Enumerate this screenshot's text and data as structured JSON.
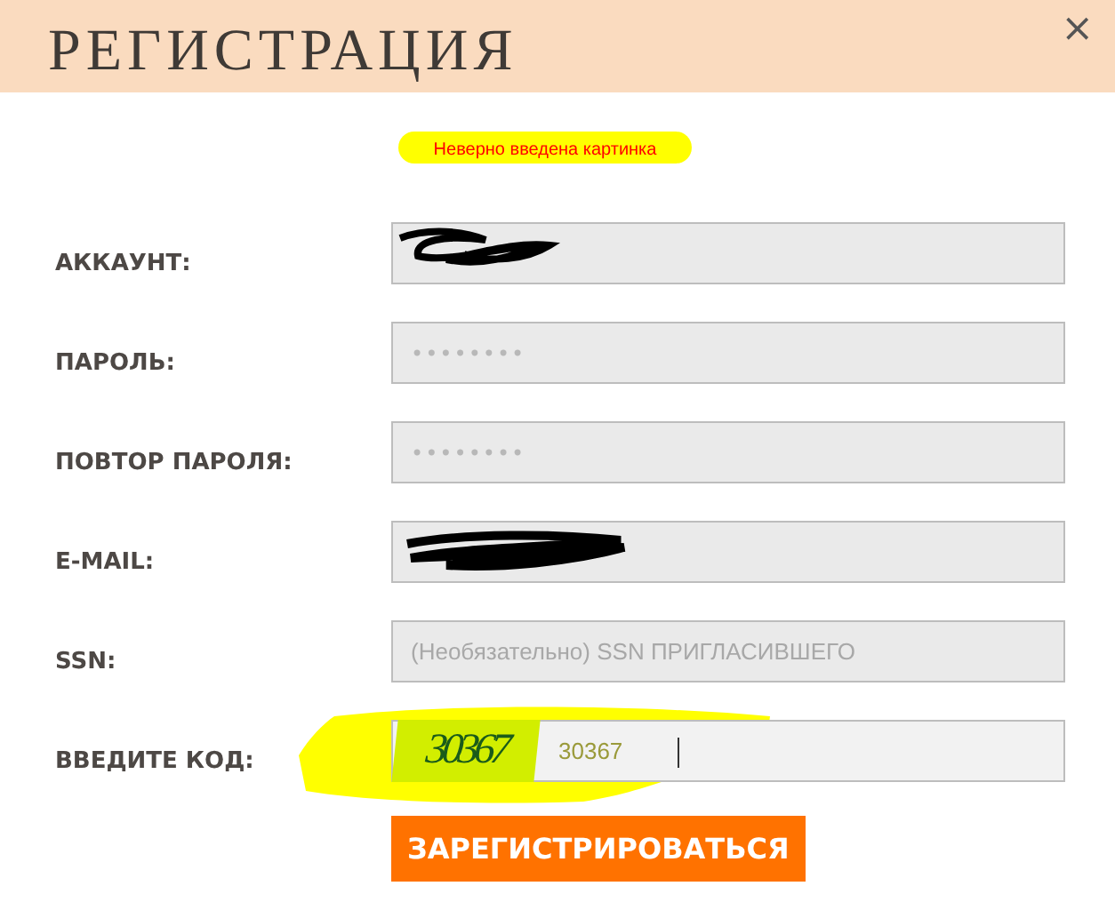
{
  "dialog": {
    "title": "РЕГИСТРАЦИЯ",
    "close": "×"
  },
  "error": {
    "text": "Неверно введена картинка",
    "highlighted": true
  },
  "fields": [
    {
      "kind": "scribbled",
      "label": "АККАУНТ:"
    },
    {
      "kind": "password",
      "label": "ПАРОЛЬ:",
      "value": "••••••••"
    },
    {
      "kind": "password",
      "label": "ПОВТОР ПАРОЛЯ:",
      "value": "••••••••"
    },
    {
      "kind": "scribbled",
      "label": "E-MAIL:"
    },
    {
      "kind": "text",
      "label": "SSN:",
      "placeholder": "(Необязательно) SSN ПРИГЛАСИВШЕГО"
    },
    {
      "kind": "captcha",
      "label": "ВВЕДИТЕ КОД:",
      "captcha": "30367",
      "value": "30367",
      "highlighted": true
    }
  ],
  "submit": "ЗАРЕГИСТРИРОВАТЬСЯ"
}
